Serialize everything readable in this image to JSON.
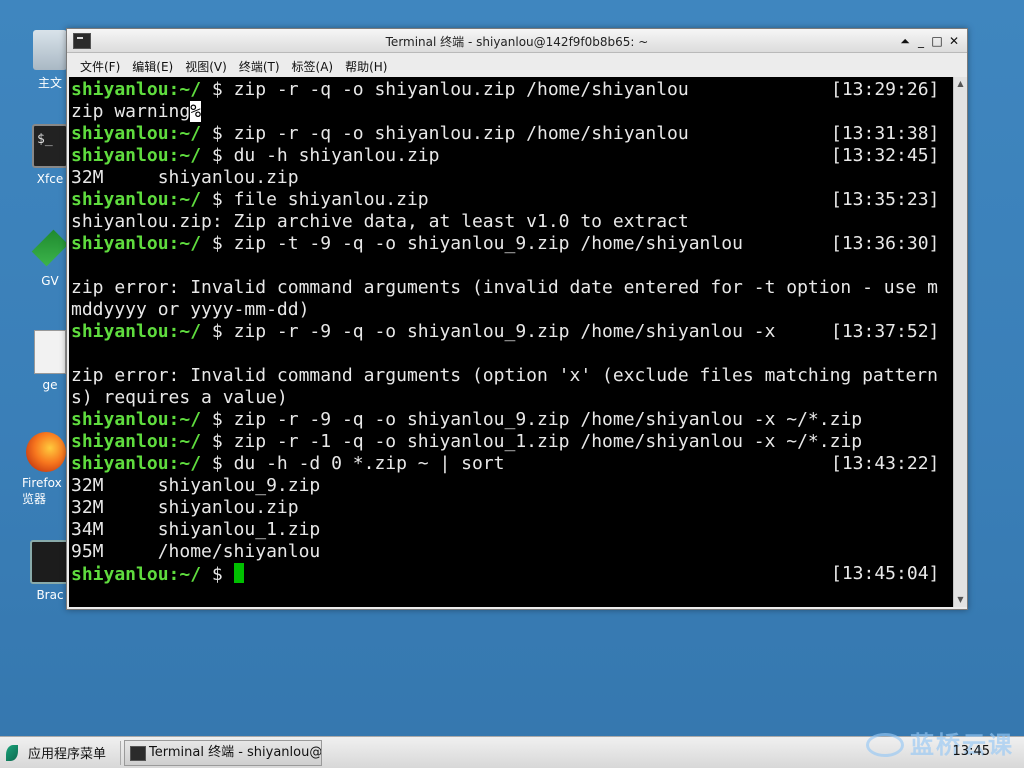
{
  "desktop": {
    "icons": [
      {
        "label": "主文"
      },
      {
        "label": "Xfce",
        "glyph": "$_"
      },
      {
        "label": "GV"
      },
      {
        "label": "ge"
      },
      {
        "label": "Firefox 览器"
      },
      {
        "label": "Brac"
      }
    ]
  },
  "window": {
    "title": "Terminal 终端 - shiyanlou@142f9f0b8b65: ~",
    "buttons": {
      "shade": "⏶",
      "minimize": "_",
      "maximize": "□",
      "close": "✕"
    },
    "menu": [
      "文件(F)",
      "编辑(E)",
      "视图(V)",
      "终端(T)",
      "标签(A)",
      "帮助(H)"
    ]
  },
  "terminal": {
    "prompt_user": "shiyanlou",
    "prompt_path": ":~/",
    "lines": [
      {
        "kind": "cmd",
        "text": " $ zip -r -q -o shiyanlou.zip /home/shiyanlou",
        "time": "[13:29:26]"
      },
      {
        "kind": "out",
        "text": "zip warning",
        "hl": "%"
      },
      {
        "kind": "cmd",
        "text": " $ zip -r -q -o shiyanlou.zip /home/shiyanlou",
        "time": "[13:31:38]"
      },
      {
        "kind": "cmd",
        "text": " $ du -h shiyanlou.zip",
        "time": "[13:32:45]"
      },
      {
        "kind": "out",
        "text": "32M     shiyanlou.zip"
      },
      {
        "kind": "cmd",
        "text": " $ file shiyanlou.zip",
        "time": "[13:35:23]"
      },
      {
        "kind": "out",
        "text": "shiyanlou.zip: Zip archive data, at least v1.0 to extract"
      },
      {
        "kind": "cmd",
        "text": " $ zip -t -9 -q -o shiyanlou_9.zip /home/shiyanlou",
        "time": "[13:36:30]"
      },
      {
        "kind": "out",
        "text": ""
      },
      {
        "kind": "out",
        "text": "zip error: Invalid command arguments (invalid date entered for -t option - use m"
      },
      {
        "kind": "out",
        "text": "mddyyyy or yyyy-mm-dd)"
      },
      {
        "kind": "cmd",
        "text": " $ zip -r -9 -q -o shiyanlou_9.zip /home/shiyanlou -x",
        "time": "[13:37:52]"
      },
      {
        "kind": "out",
        "text": ""
      },
      {
        "kind": "out",
        "text": "zip error: Invalid command arguments (option 'x' (exclude files matching pattern"
      },
      {
        "kind": "out",
        "text": "s) requires a value)"
      },
      {
        "kind": "cmd",
        "text": " $ zip -r -9 -q -o shiyanlou_9.zip /home/shiyanlou -x ~/*.zip"
      },
      {
        "kind": "cmd",
        "text": " $ zip -r -1 -q -o shiyanlou_1.zip /home/shiyanlou -x ~/*.zip"
      },
      {
        "kind": "cmd",
        "text": " $ du -h -d 0 *.zip ~ | sort",
        "time": "[13:43:22]"
      },
      {
        "kind": "out",
        "text": "32M     shiyanlou_9.zip"
      },
      {
        "kind": "out",
        "text": "32M     shiyanlou.zip"
      },
      {
        "kind": "out",
        "text": "34M     shiyanlou_1.zip"
      },
      {
        "kind": "out",
        "text": "95M     /home/shiyanlou"
      },
      {
        "kind": "cmd",
        "text": " $ ",
        "time": "[13:45:04]",
        "cursor": true
      }
    ]
  },
  "scrollbar": {
    "up": "▲",
    "down": "▼"
  },
  "taskbar": {
    "app_menu_label": "应用程序菜单",
    "task_label": "Terminal 终端 - shiyanlou@…",
    "clock": "13:45",
    "watermark": "蓝桥云课"
  },
  "colors": {
    "prompt": "#5fdc3e",
    "cursor": "#00c000",
    "desktop": "#3a7fb8"
  }
}
